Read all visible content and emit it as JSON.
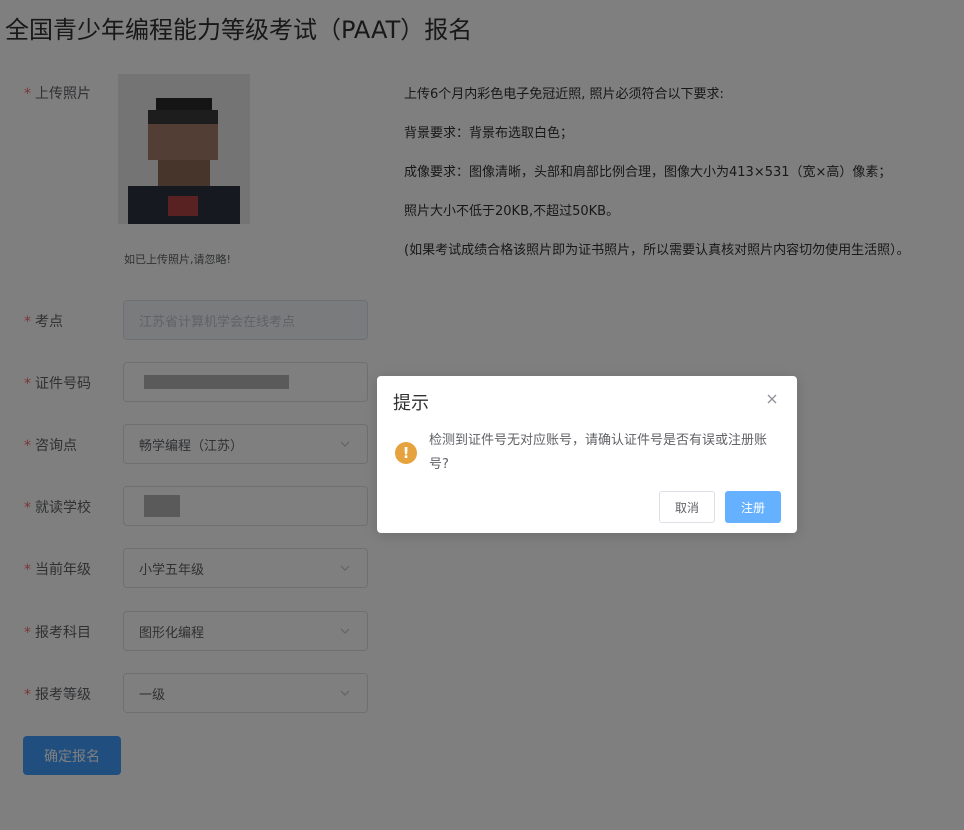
{
  "page": {
    "title": "全国青少年编程能力等级考试（PAAT）报名"
  },
  "labels": {
    "required_mark": "*",
    "photo": "上传照片",
    "exam_site": "考点",
    "id_number": "证件号码",
    "consult_point": "咨询点",
    "school": "就读学校",
    "grade": "当前年级",
    "subject": "报考科目",
    "level": "报考等级"
  },
  "photo": {
    "hint": "如已上传照片,请忽略!",
    "requirements": [
      "上传6个月内彩色电子免冠近照, 照片必须符合以下要求:",
      "背景要求：背景布选取白色；",
      "成像要求：图像清晰，头部和肩部比例合理，图像大小为413×531（宽×高）像素；",
      "照片大小不低于20KB,不超过50KB。",
      "(如果考试成绩合格该照片即为证书照片，所以需要认真核对照片内容切勿使用生活照）。"
    ]
  },
  "fields": {
    "exam_site": "江苏省计算机学会在线考点",
    "consult_point": "畅学编程（江苏）",
    "grade": "小学五年级",
    "subject": "图形化编程",
    "level": "一级"
  },
  "submit_label": "确定报名",
  "dialog": {
    "title": "提示",
    "message": "检测到证件号无对应账号，请确认证件号是否有误或注册账号?",
    "warn_glyph": "!",
    "cancel_label": "取消",
    "confirm_label": "注册"
  },
  "colors": {
    "primary": "#409eff",
    "required": "#f56c6c",
    "warning": "#e6a23c"
  }
}
